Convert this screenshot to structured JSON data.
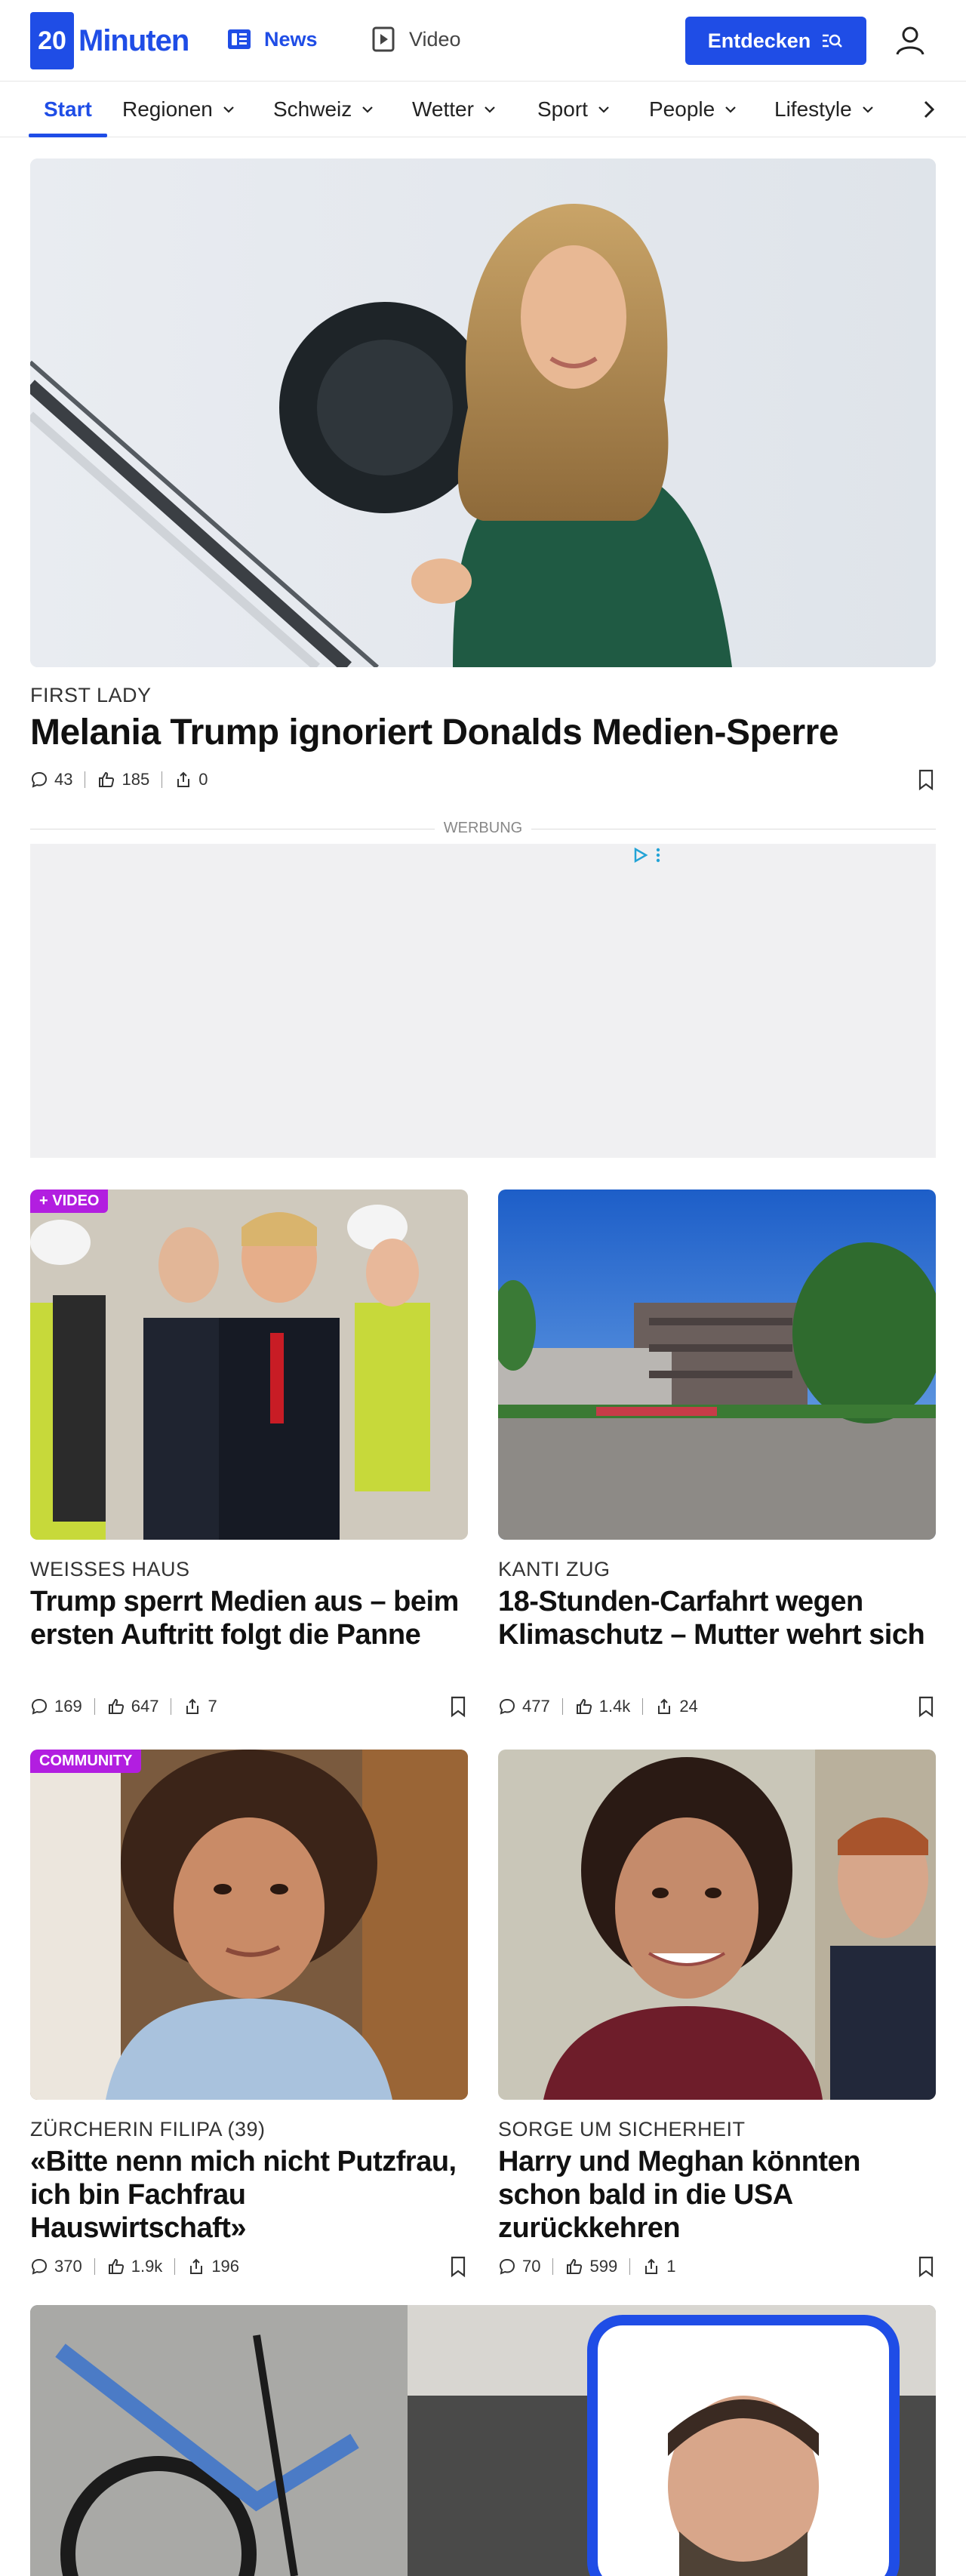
{
  "header": {
    "logo_number": "20",
    "logo_text": "Minuten",
    "news_label": "News",
    "video_label": "Video",
    "entdecken_label": "Entdecken"
  },
  "subnav": {
    "items": [
      {
        "label": "Start",
        "active": true
      },
      {
        "label": "Regionen"
      },
      {
        "label": "Schweiz"
      },
      {
        "label": "Wetter"
      },
      {
        "label": "Sport"
      },
      {
        "label": "People"
      },
      {
        "label": "Lifestyle"
      }
    ]
  },
  "hero": {
    "kicker": "FIRST LADY",
    "headline": "Melania Trump ignoriert Donalds Medien-Sperre",
    "comments": "43",
    "likes": "185",
    "shares": "0"
  },
  "ad": {
    "label": "WERBUNG"
  },
  "cards": [
    {
      "badge": "+ VIDEO",
      "kicker": "WEISSES HAUS",
      "headline": "Trump sperrt Medien aus – beim ersten Auftritt folgt die Panne",
      "comments": "169",
      "likes": "647",
      "shares": "7"
    },
    {
      "badge": "",
      "kicker": "KANTI ZUG",
      "headline": "18-Stunden-Carfahrt wegen Klimaschutz – Mutter wehrt sich",
      "comments": "477",
      "likes": "1.4k",
      "shares": "24"
    },
    {
      "badge": "COMMUNITY",
      "kicker": "ZÜRCHERIN FILIPA (39)",
      "headline": "«Bitte nenn mich nicht Putzfrau, ich bin Fachfrau Hauswirtschaft»",
      "comments": "370",
      "likes": "1.9k",
      "shares": "196"
    },
    {
      "badge": "",
      "kicker": "SORGE UM SICHERHEIT",
      "headline": "Harry und Meghan könnten schon bald in die USA zurückkehren",
      "comments": "70",
      "likes": "599",
      "shares": "1"
    }
  ],
  "colors": {
    "brand": "#1f4de6",
    "badge": "#b21ee0"
  }
}
